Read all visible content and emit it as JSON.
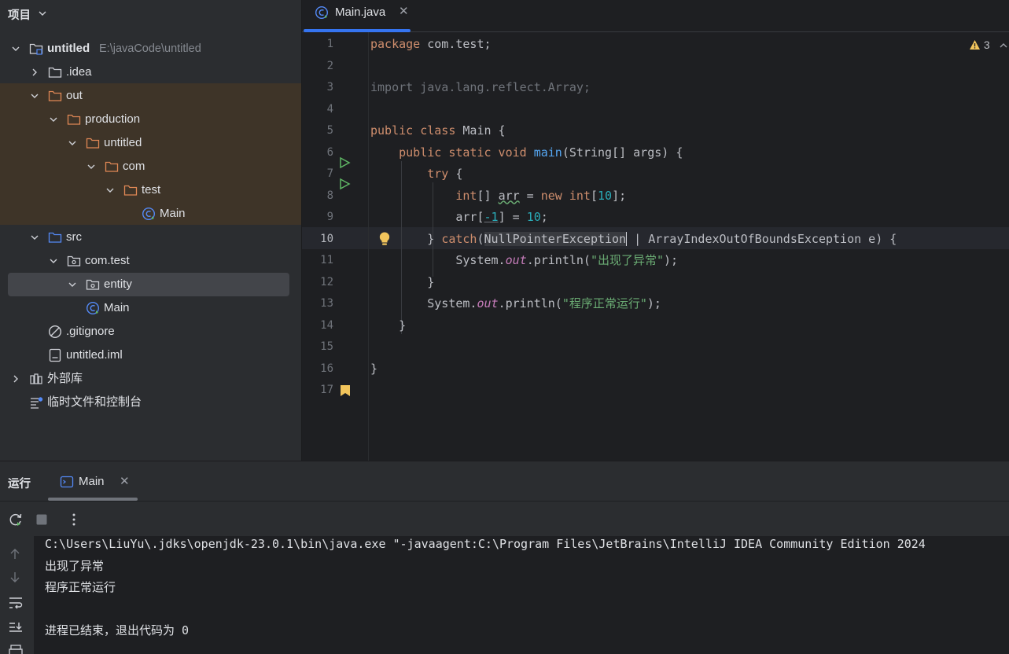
{
  "project_panel": {
    "title": "项目",
    "tree": [
      {
        "label": "untitled",
        "path": "E:\\javaCode\\untitled"
      },
      {
        "label": ".idea"
      },
      {
        "label": "out"
      },
      {
        "label": "production"
      },
      {
        "label": "untitled"
      },
      {
        "label": "com"
      },
      {
        "label": "test"
      },
      {
        "label": "Main"
      },
      {
        "label": "src"
      },
      {
        "label": "com.test"
      },
      {
        "label": "entity"
      },
      {
        "label": "Main"
      },
      {
        "label": ".gitignore"
      },
      {
        "label": "untitled.iml"
      },
      {
        "label": "外部库"
      },
      {
        "label": "临时文件和控制台"
      }
    ]
  },
  "editor": {
    "tab_label": "Main.java",
    "warning_count": "3",
    "line_numbers": [
      "1",
      "2",
      "3",
      "4",
      "5",
      "6",
      "7",
      "8",
      "9",
      "10",
      "11",
      "12",
      "13",
      "14",
      "15",
      "16",
      "17"
    ],
    "current_line": "10",
    "code": {
      "pkg": "com.test;",
      "import_stmt": "import java.lang.reflect.Array;",
      "class_name": "Main {",
      "main_name": "main",
      "main_args": "(String[] args) {",
      "arr_name": "arr",
      "arr_size": "10",
      "idx": "-1",
      "assign_val": "10",
      "ex1": "NullPointerException",
      "ex2": " | ArrayIndexOutOfBoundsException e) {",
      "msg1": "\"出现了异常\"",
      "msg2": "\"程序正常运行\""
    }
  },
  "run_panel": {
    "title": "运行",
    "tab_label": "Main",
    "console_lines": [
      "C:\\Users\\LiuYu\\.jdks\\openjdk-23.0.1\\bin\\java.exe \"-javaagent:C:\\Program Files\\JetBrains\\IntelliJ IDEA Community Edition 2024",
      "出现了异常",
      "程序正常运行",
      "",
      "进程已结束，退出代码为 0"
    ]
  },
  "colors": {
    "accent": "#3574f0",
    "keyword": "#cf8e6d",
    "string": "#6aab73",
    "number": "#2aacb8",
    "function": "#56a8f5",
    "static_field": "#c77dbb",
    "folder_highlight": "#3e3428"
  }
}
